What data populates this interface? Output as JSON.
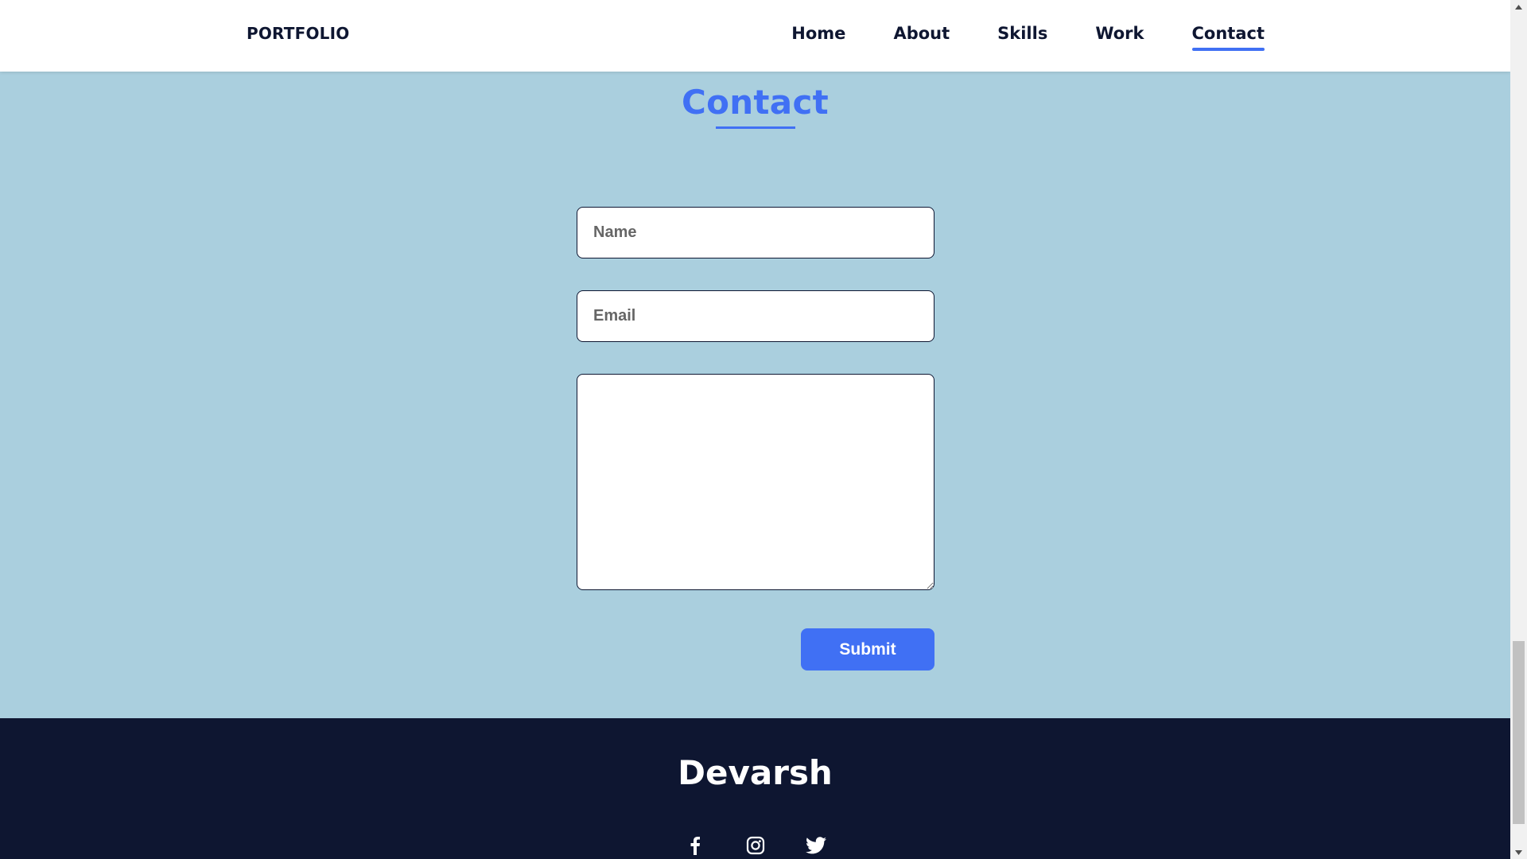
{
  "header": {
    "logo": "PORTFOLIO",
    "nav": [
      {
        "label": "Home",
        "active": false
      },
      {
        "label": "About",
        "active": false
      },
      {
        "label": "Skills",
        "active": false
      },
      {
        "label": "Work",
        "active": false
      },
      {
        "label": "Contact",
        "active": true
      }
    ]
  },
  "contact": {
    "title": "Contact",
    "name_placeholder": "Name",
    "email_placeholder": "Email",
    "message_placeholder": "",
    "submit_label": "Submit"
  },
  "footer": {
    "name": "Devarsh",
    "socials": [
      "facebook-icon",
      "instagram-icon",
      "twitter-icon"
    ]
  },
  "colors": {
    "accent": "#4070f4",
    "section_bg": "#aacfde",
    "footer_bg": "#0e1631",
    "text_dark": "#0e1631"
  }
}
